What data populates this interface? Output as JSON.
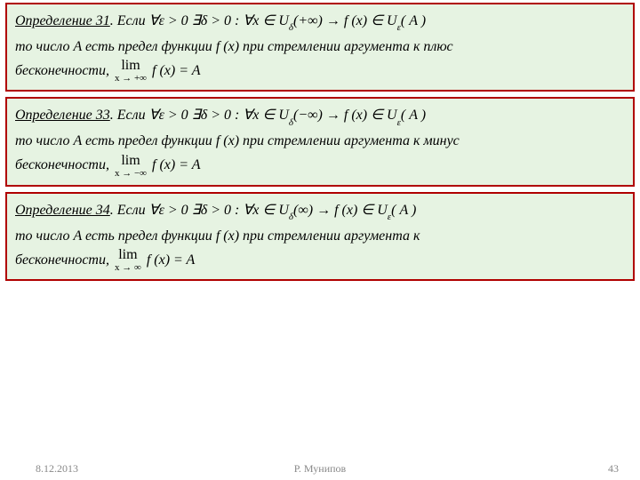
{
  "defs": [
    {
      "title": "Определение 31",
      "intro": ". Если",
      "cond": "∀ε > 0  ∃δ > 0 :   ∀x ∈ U",
      "delta": "δ",
      "neigh_arg": "(+∞)   →   f (x) ∈ U",
      "eps": "ε",
      "afterU": "( A )",
      "line2a": "то число  A   есть ",
      "limit_of": "предел функции",
      "fx": "  f (x)  ",
      "phrase": "при стремлении аргумента к плюс",
      "line3a": "бесконечности",
      "lim_sub": "x → +∞",
      "lim_expr": " f (x) = A"
    },
    {
      "title": "Определение 33",
      "intro": ". Если",
      "cond": "∀ε > 0  ∃δ > 0 :   ∀x ∈ U",
      "delta": "δ",
      "neigh_arg": "(−∞)   →   f (x) ∈ U",
      "eps": "ε",
      "afterU": "( A )",
      "line2a": "то число  A   есть ",
      "limit_of": "предел функции",
      "fx": "  f (x)  ",
      "phrase": "при стремлении аргумента к минус",
      "line3a": "бесконечности",
      "lim_sub": "x → −∞",
      "lim_expr": " f (x) = A"
    },
    {
      "title": "Определение 34",
      "intro": ". Если",
      "cond": "∀ε > 0  ∃δ > 0 :   ∀x ∈ U",
      "delta": "δ",
      "neigh_arg": "(∞)   →   f (x) ∈ U",
      "eps": "ε",
      "afterU": "( A )",
      "line2a": "то число  A   есть ",
      "limit_of": "предел функции",
      "fx": "  f (x)  ",
      "phrase": "при стремлении аргумента к",
      "line3a": "бесконечности",
      "lim_sub": "x → ∞",
      "lim_expr": " f (x) = A"
    }
  ],
  "comma": ",  ",
  "lim_word": "lim",
  "footer": {
    "date": "8.12.2013",
    "author": "Р. Мунипов",
    "page": "43"
  }
}
